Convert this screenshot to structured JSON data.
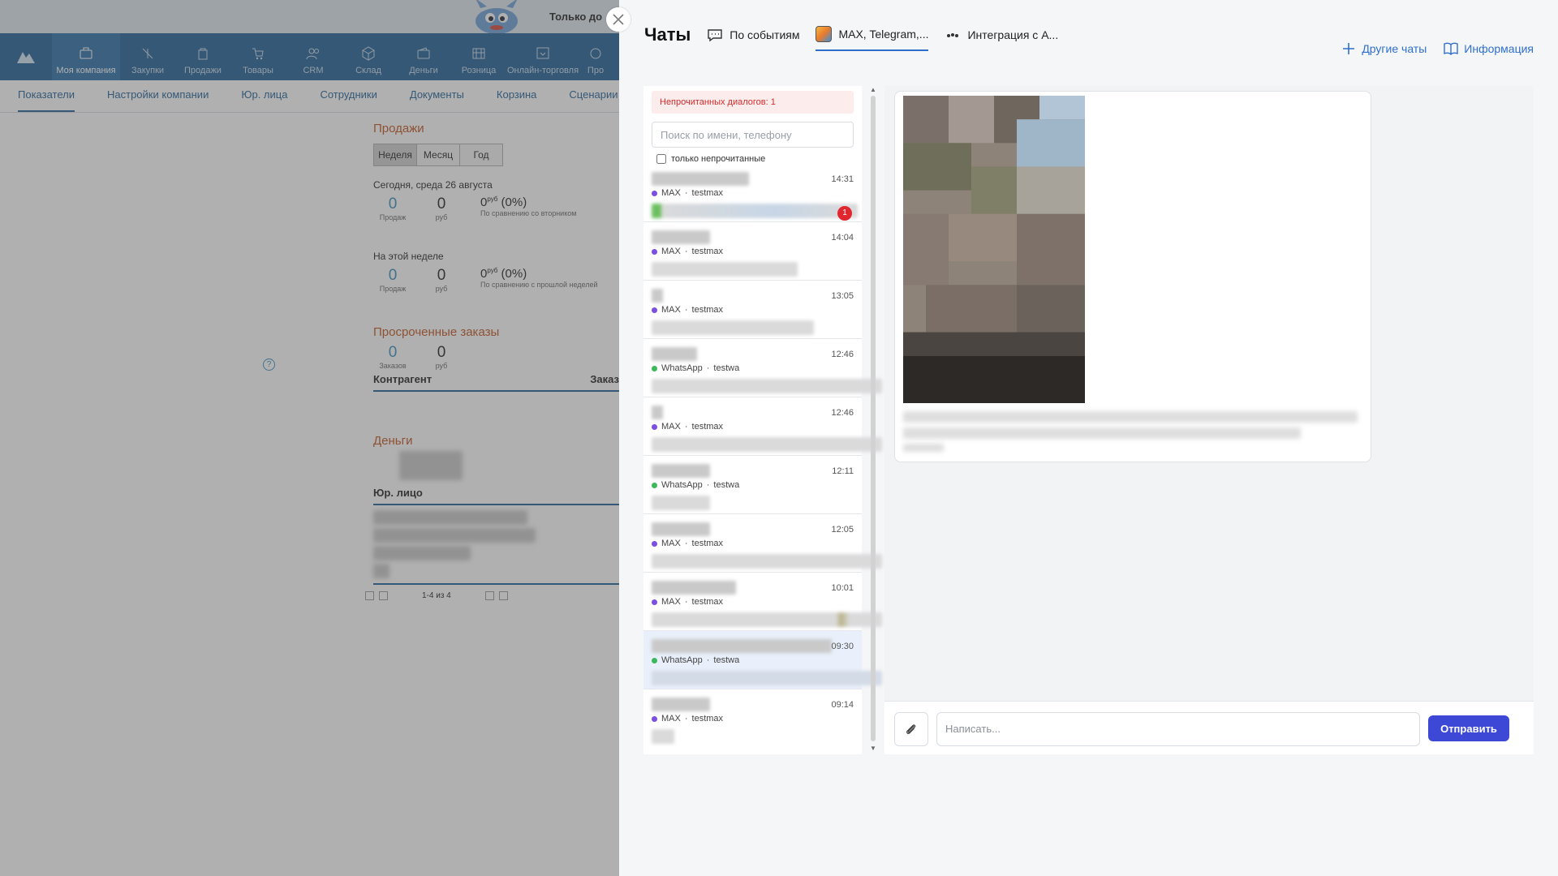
{
  "background_app": {
    "promo": "Только до",
    "nav": [
      {
        "label": "Моя компания",
        "icon": "briefcase-icon",
        "active": true
      },
      {
        "label": "Закупки",
        "icon": "purchase-icon"
      },
      {
        "label": "Продажи",
        "icon": "bag-icon"
      },
      {
        "label": "Товары",
        "icon": "cart-icon"
      },
      {
        "label": "CRM",
        "icon": "people-icon"
      },
      {
        "label": "Склад",
        "icon": "box-icon"
      },
      {
        "label": "Деньги",
        "icon": "wallet-icon"
      },
      {
        "label": "Розница",
        "icon": "register-icon"
      },
      {
        "label": "Онлайн-торговля",
        "icon": "online-store-icon"
      },
      {
        "label": "Про",
        "icon": "more-icon"
      }
    ],
    "subnav": [
      "Показатели",
      "Настройки компании",
      "Юр. лица",
      "Сотрудники",
      "Документы",
      "Корзина",
      "Сценарии"
    ],
    "sales": {
      "title": "Продажи",
      "periods": [
        "Неделя",
        "Месяц",
        "Год"
      ],
      "today_label": "Сегодня, среда 26 августа",
      "today": {
        "sales": "0",
        "sales_lbl": "Продаж",
        "rub": "0",
        "rub_lbl": "руб",
        "cmp": "0",
        "cmp_unit": "руб",
        "cmp_pct": "(0%)",
        "cmp_lbl": "По сравнению со вторником"
      },
      "week_label": "На этой неделе",
      "week": {
        "sales": "0",
        "sales_lbl": "Продаж",
        "rub": "0",
        "rub_lbl": "руб",
        "cmp": "0",
        "cmp_unit": "руб",
        "cmp_pct": "(0%)",
        "cmp_lbl": "По сравнению с прошлой неделей"
      }
    },
    "overdue": {
      "title": "Просроченные заказы",
      "orders": "0",
      "orders_lbl": "Заказов",
      "rub": "0",
      "rub_lbl": "руб",
      "col_counterparty": "Контрагент",
      "col_order": "Заказ"
    },
    "money": {
      "title": "Деньги",
      "col_entity": "Юр. лицо",
      "pager": "1-4 из 4"
    }
  },
  "panel": {
    "title": "Чаты",
    "tabs": [
      {
        "label": "По событиям",
        "icon": "chat-bubble-icon"
      },
      {
        "label": "MAX, Telegram,...",
        "icon": "app-icon",
        "active": true
      },
      {
        "label": "Интеграция с А...",
        "icon": "avito-icon"
      }
    ],
    "links": [
      {
        "label": "Другие чаты",
        "icon": "plus-icon"
      },
      {
        "label": "Информация",
        "icon": "book-icon"
      }
    ],
    "unread_banner": "Непрочитанных диалогов: 1",
    "search_placeholder": "Поиск по имени, телефону",
    "unread_only_label": "только непрочитанные",
    "chats": [
      {
        "time": "14:31",
        "channel": "MAX",
        "account": "testmax",
        "unread": "1"
      },
      {
        "time": "14:04",
        "channel": "MAX",
        "account": "testmax"
      },
      {
        "time": "13:05",
        "channel": "MAX",
        "account": "testmax"
      },
      {
        "time": "12:46",
        "channel": "WhatsApp",
        "account": "testwa"
      },
      {
        "time": "12:46",
        "channel": "MAX",
        "account": "testmax"
      },
      {
        "time": "12:11",
        "channel": "WhatsApp",
        "account": "testwa"
      },
      {
        "time": "12:05",
        "channel": "MAX",
        "account": "testmax"
      },
      {
        "time": "10:01",
        "channel": "MAX",
        "account": "testmax"
      },
      {
        "time": "09:30",
        "channel": "WhatsApp",
        "account": "testwa",
        "selected": true
      },
      {
        "time": "09:14",
        "channel": "MAX",
        "account": "testmax"
      }
    ],
    "composer": {
      "placeholder": "Написать...",
      "send_label": "Отправить"
    }
  }
}
